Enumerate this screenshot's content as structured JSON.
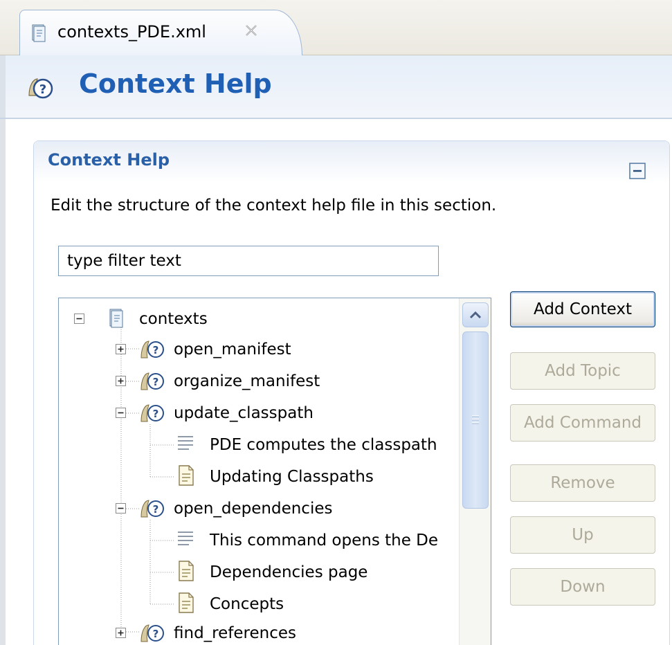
{
  "editor_tab": {
    "label": "contexts_PDE.xml",
    "icon": "xml-file-icon"
  },
  "form_header": {
    "title": "Context Help",
    "icon": "context-help-icon"
  },
  "section": {
    "title": "Context Help",
    "description": "Edit the structure of the context help file in this section.",
    "filter_value": "type filter text"
  },
  "tree": {
    "root": {
      "label": "contexts",
      "expanded": true
    },
    "items": [
      {
        "label": "open_manifest",
        "type": "context",
        "expanded": false
      },
      {
        "label": "organize_manifest",
        "type": "context",
        "expanded": false
      },
      {
        "label": "update_classpath",
        "type": "context",
        "expanded": true
      },
      {
        "label": "PDE computes the classpath",
        "type": "description"
      },
      {
        "label": "Updating Classpaths",
        "type": "topic"
      },
      {
        "label": "open_dependencies",
        "type": "context",
        "expanded": true
      },
      {
        "label": "This command opens the De",
        "type": "description"
      },
      {
        "label": "Dependencies page",
        "type": "topic"
      },
      {
        "label": "Concepts",
        "type": "topic"
      },
      {
        "label": "find_references",
        "type": "context",
        "expanded": false
      }
    ]
  },
  "buttons": {
    "add_context": "Add Context",
    "add_topic": "Add Topic",
    "add_command": "Add Command",
    "remove": "Remove",
    "up": "Up",
    "down": "Down"
  },
  "colors": {
    "title_blue": "#1f5fb4",
    "section_title": "#2a60a8",
    "disabled_text": "#adaa9a"
  }
}
